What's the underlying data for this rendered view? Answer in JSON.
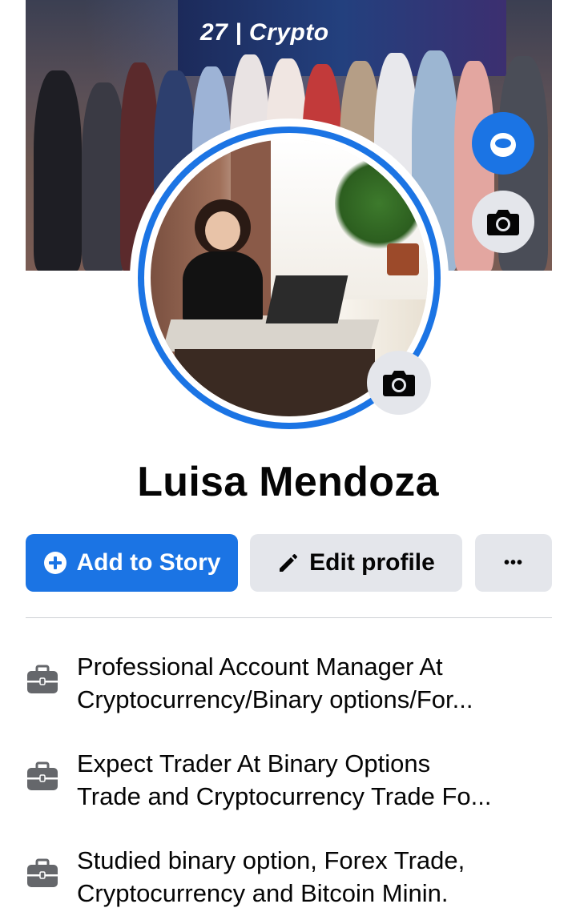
{
  "cover": {
    "banner_text": "27 | Crypto"
  },
  "profile": {
    "name": "Luisa Mendoza"
  },
  "actions": {
    "add_story_label": "Add to Story",
    "edit_profile_label": "Edit profile",
    "more_label": "•••"
  },
  "info": [
    {
      "icon": "briefcase-icon",
      "line1": "Professional Account Manager At",
      "line2": "Cryptocurrency/Binary options/For..."
    },
    {
      "icon": "briefcase-icon",
      "line1": "Expect Trader At Binary Options",
      "line2": "Trade and Cryptocurrency Trade Fo..."
    },
    {
      "icon": "briefcase-icon",
      "line1": "Studied binary option, Forex Trade,",
      "line2": "Cryptocurrency and Bitcoin Minin."
    }
  ],
  "colors": {
    "primary": "#1b74e4",
    "secondary_button": "#e4e6eb",
    "text": "#050505",
    "icon_gray": "#65676b"
  }
}
